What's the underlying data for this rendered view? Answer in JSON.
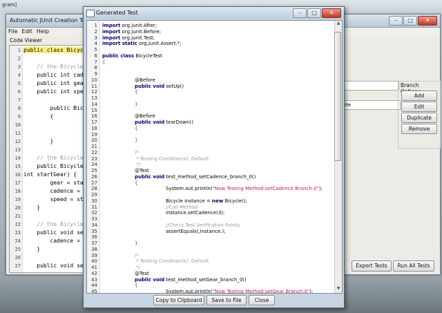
{
  "desktop": {
    "label": "gram]"
  },
  "main_window": {
    "title": "Automatic JUnit Creation Tool",
    "menu": [
      "File",
      "Edit",
      "Help"
    ],
    "code_viewer_label": "Code Viewer",
    "code_lines": [
      {
        "n": "1",
        "t": "public class Bicycle {",
        "hl": true
      },
      {
        "n": "2",
        "t": "",
        "hl": false
      },
      {
        "n": "3",
        "t": "    // the Bicycle class has",
        "cm": true
      },
      {
        "n": "4",
        "t": "    public int cadence;"
      },
      {
        "n": "5",
        "t": "    public int gear;"
      },
      {
        "n": "6",
        "t": "    public int speed;"
      },
      {
        "n": "7",
        "t": ""
      },
      {
        "n": "8",
        "t": "        public Bicycle"
      },
      {
        "n": "9",
        "t": "        {"
      },
      {
        "n": "10",
        "t": ""
      },
      {
        "n": "11",
        "t": ""
      },
      {
        "n": "12",
        "t": "        }"
      },
      {
        "n": "13",
        "t": ""
      },
      {
        "n": "14",
        "t": "    // the Bicycle class has",
        "cm": true
      },
      {
        "n": "15",
        "t": "    public Bicycle(int startCadence,"
      },
      {
        "n": "16",
        "t": "int startGear) {"
      },
      {
        "n": "17",
        "t": "        gear = startGear;"
      },
      {
        "n": "18",
        "t": "        cadence = startCadence;"
      },
      {
        "n": "19",
        "t": "        speed = startSpeed;"
      },
      {
        "n": "20",
        "t": "    }"
      },
      {
        "n": "21",
        "t": ""
      },
      {
        "n": "22",
        "t": "    // the Bicycle class has",
        "cm": true
      },
      {
        "n": "23",
        "t": "    public void setCadence(int"
      },
      {
        "n": "24",
        "t": "        cadence = newValue;"
      },
      {
        "n": "25",
        "t": "    }"
      },
      {
        "n": "26",
        "t": ""
      },
      {
        "n": "27",
        "t": "    public void setGear(int"
      }
    ],
    "field_value": "ite",
    "branch_options_title": "Branch Options",
    "buttons": {
      "add": "Add",
      "edit": "Edit",
      "duplicate": "Duplicate",
      "remove": "Remove",
      "export": "Export Tests",
      "run_all": "Run All Tests"
    }
  },
  "dialog": {
    "title": "Generated Test",
    "lines": [
      {
        "n": "1",
        "parts": [
          {
            "k": "kw",
            "t": "import"
          },
          {
            "t": " org.junit.After;"
          }
        ]
      },
      {
        "n": "2",
        "parts": [
          {
            "k": "kw",
            "t": "import"
          },
          {
            "t": " org.junit.Before;"
          }
        ]
      },
      {
        "n": "3",
        "parts": [
          {
            "k": "kw",
            "t": "import"
          },
          {
            "t": " org.junit.Test;"
          }
        ]
      },
      {
        "n": "4",
        "parts": [
          {
            "k": "kw",
            "t": "import static"
          },
          {
            "t": " org.junit.Assert.*;"
          }
        ]
      },
      {
        "n": "5",
        "parts": []
      },
      {
        "n": "6",
        "parts": [
          {
            "k": "kw",
            "t": "public class"
          },
          {
            "t": " BicycleTest"
          }
        ]
      },
      {
        "n": "7",
        "parts": [
          {
            "k": "str",
            "t": "{"
          }
        ]
      },
      {
        "n": "8",
        "parts": []
      },
      {
        "n": "9",
        "parts": []
      },
      {
        "n": "10",
        "indent": 1,
        "parts": [
          {
            "t": "@Before"
          }
        ]
      },
      {
        "n": "11",
        "indent": 1,
        "parts": [
          {
            "k": "kw",
            "t": "public void"
          },
          {
            "t": " setUp()"
          }
        ]
      },
      {
        "n": "12",
        "indent": 1,
        "parts": [
          {
            "k": "str",
            "t": "{"
          }
        ]
      },
      {
        "n": "13",
        "parts": []
      },
      {
        "n": "14",
        "indent": 1,
        "parts": [
          {
            "k": "str",
            "t": "}"
          }
        ]
      },
      {
        "n": "15",
        "parts": []
      },
      {
        "n": "16",
        "indent": 1,
        "parts": [
          {
            "t": "@Before"
          }
        ]
      },
      {
        "n": "17",
        "indent": 1,
        "parts": [
          {
            "k": "kw",
            "t": "public void"
          },
          {
            "t": " tearDown()"
          }
        ]
      },
      {
        "n": "18",
        "indent": 1,
        "parts": [
          {
            "k": "str",
            "t": "{"
          }
        ]
      },
      {
        "n": "19",
        "parts": []
      },
      {
        "n": "20",
        "indent": 1,
        "parts": [
          {
            "k": "str",
            "t": "}"
          }
        ]
      },
      {
        "n": "21",
        "parts": []
      },
      {
        "n": "22",
        "indent": 1,
        "parts": [
          {
            "k": "cmt",
            "t": "/*"
          }
        ]
      },
      {
        "n": "23",
        "indent": 1,
        "parts": [
          {
            "k": "cmt",
            "t": " * Testing Condition(s): Default"
          }
        ]
      },
      {
        "n": "24",
        "indent": 1,
        "parts": [
          {
            "k": "cmt",
            "t": " */"
          }
        ]
      },
      {
        "n": "25",
        "indent": 1,
        "parts": [
          {
            "t": "@Test"
          }
        ]
      },
      {
        "n": "26",
        "indent": 1,
        "parts": [
          {
            "k": "kw",
            "t": "public void"
          },
          {
            "t": " test_method_setCadence_branch_0()"
          }
        ]
      },
      {
        "n": "27",
        "indent": 1,
        "parts": [
          {
            "k": "str",
            "t": "{"
          }
        ]
      },
      {
        "n": "28",
        "indent": 2,
        "parts": [
          {
            "t": "System.out.println("
          },
          {
            "k": "str",
            "t": "\"Now Testing Method:setCadence Branch:0\""
          },
          {
            "t": ");"
          }
        ]
      },
      {
        "n": "29",
        "parts": []
      },
      {
        "n": "30",
        "indent": 2,
        "parts": [
          {
            "t": "Bicycle instance = "
          },
          {
            "k": "kw",
            "t": "new"
          },
          {
            "t": " Bicycle();"
          }
        ]
      },
      {
        "n": "31",
        "indent": 2,
        "parts": [
          {
            "k": "cmt",
            "t": "//Call Method"
          }
        ]
      },
      {
        "n": "32",
        "indent": 2,
        "parts": [
          {
            "t": "instance.setCadence(3);"
          }
        ]
      },
      {
        "n": "33",
        "parts": []
      },
      {
        "n": "34",
        "indent": 2,
        "parts": [
          {
            "k": "cmt",
            "t": "//Check Test Verification Points"
          }
        ]
      },
      {
        "n": "35",
        "indent": 2,
        "parts": [
          {
            "t": "assertEquals(,instance.);"
          }
        ]
      },
      {
        "n": "36",
        "parts": []
      },
      {
        "n": "37",
        "indent": 1,
        "parts": [
          {
            "k": "str",
            "t": "}"
          }
        ]
      },
      {
        "n": "38",
        "parts": []
      },
      {
        "n": "39",
        "indent": 1,
        "parts": [
          {
            "k": "cmt",
            "t": "/*"
          }
        ]
      },
      {
        "n": "40",
        "indent": 1,
        "parts": [
          {
            "k": "cmt",
            "t": " * Testing Condition(s): Default"
          }
        ]
      },
      {
        "n": "41",
        "indent": 1,
        "parts": [
          {
            "k": "cmt",
            "t": " */"
          }
        ]
      },
      {
        "n": "42",
        "indent": 1,
        "parts": [
          {
            "t": "@Test"
          }
        ]
      },
      {
        "n": "43",
        "indent": 1,
        "parts": [
          {
            "k": "kw",
            "t": "public void"
          },
          {
            "t": " test_method_setGear_branch_0()"
          }
        ]
      },
      {
        "n": "44",
        "indent": 1,
        "parts": [
          {
            "k": "str",
            "t": "{"
          }
        ]
      },
      {
        "n": "45",
        "indent": 2,
        "parts": [
          {
            "t": "System.out.println("
          },
          {
            "k": "str",
            "t": "\"Now Testing Method:setGear Branch:0\""
          },
          {
            "t": ");"
          }
        ]
      }
    ],
    "buttons": {
      "copy": "Copy to Clipboard",
      "save": "Save to File",
      "close": "Close"
    }
  }
}
